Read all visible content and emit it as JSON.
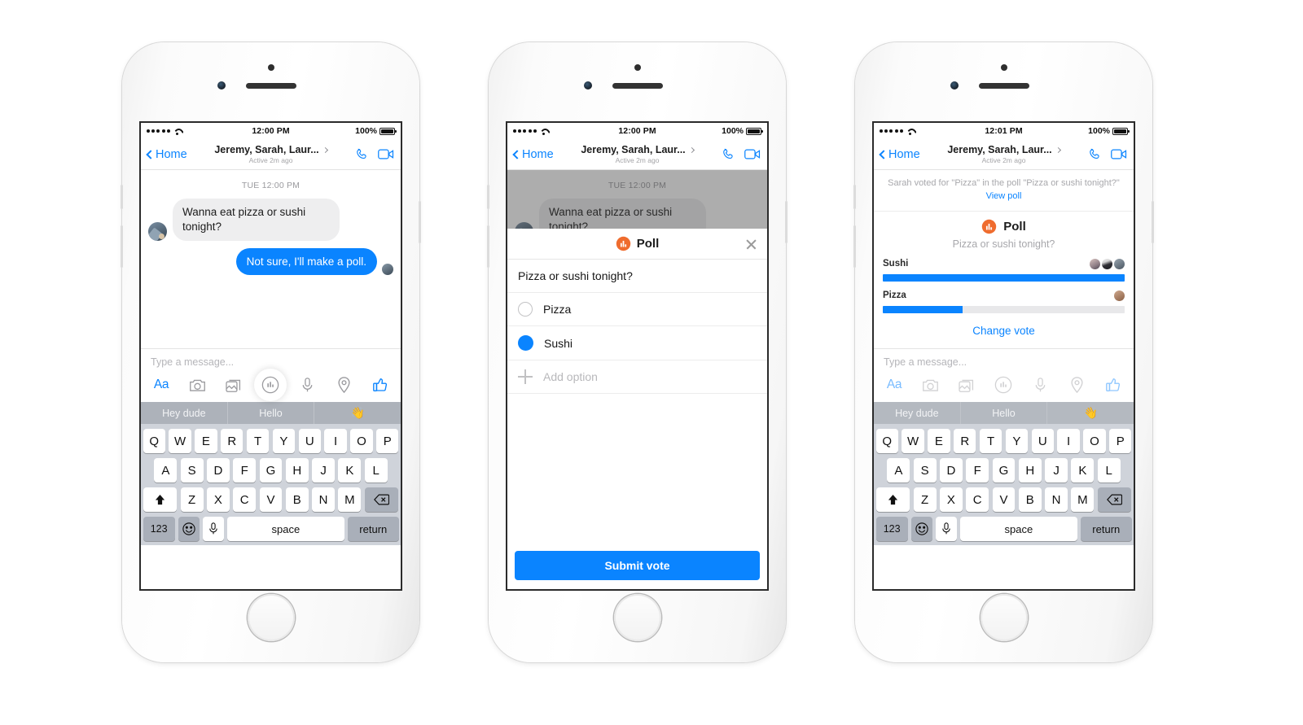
{
  "meta": {
    "accent": "#0a84ff",
    "poll_orange": "#ef6c2e",
    "bg": "#ffffff"
  },
  "keyboard": {
    "row1": [
      "Q",
      "W",
      "E",
      "R",
      "T",
      "Y",
      "U",
      "I",
      "O",
      "P"
    ],
    "row2": [
      "A",
      "S",
      "D",
      "F",
      "G",
      "H",
      "J",
      "K",
      "L"
    ],
    "row3": [
      "Z",
      "X",
      "C",
      "V",
      "B",
      "N",
      "M"
    ],
    "numeric_label": "123",
    "space_label": "space",
    "return_label": "return",
    "shift_icon": "shift-icon",
    "backspace_icon": "backspace-icon",
    "emoji_icon": "emoji-icon",
    "mic_icon": "microphone-icon"
  },
  "predictive": {
    "suggestion1": "Hey dude",
    "suggestion2": "Hello",
    "suggestion3": "👋"
  },
  "composer": {
    "placeholder": "Type a message...",
    "icons": [
      "text-format-icon",
      "camera-icon",
      "photo-gallery-icon",
      "poll-icon",
      "microphone-icon",
      "location-pin-icon",
      "thumbs-up-icon"
    ],
    "text_format_label": "Aa"
  },
  "phone1": {
    "status": {
      "time": "12:00 PM",
      "battery": "100%",
      "signal_dots": 5,
      "wifi": "wifi-icon"
    },
    "nav": {
      "back_label": "Home",
      "title": "Jeremy, Sarah, Laur...",
      "subtitle": "Active 2m ago",
      "call_icon": "phone-call-icon",
      "video_icon": "video-call-icon"
    },
    "thread": {
      "daystamp": "TUE 12:00 PM",
      "messages": [
        {
          "direction": "incoming",
          "text": "Wanna eat pizza or sushi tonight?"
        },
        {
          "direction": "outgoing",
          "text": "Not sure, I'll make a poll."
        }
      ]
    }
  },
  "phone2": {
    "status": {
      "time": "12:00 PM",
      "battery": "100%"
    },
    "nav": {
      "back_label": "Home",
      "title": "Jeremy, Sarah, Laur...",
      "subtitle": "Active 2m ago"
    },
    "thread": {
      "daystamp": "TUE 12:00 PM",
      "messages": [
        {
          "direction": "incoming",
          "text": "Wanna eat pizza or sushi tonight?"
        }
      ]
    },
    "modal": {
      "title": "Poll",
      "icon": "poll-icon",
      "close_icon": "close-icon",
      "question": "Pizza or sushi tonight?",
      "options": [
        {
          "label": "Pizza",
          "selected": false
        },
        {
          "label": "Sushi",
          "selected": true
        }
      ],
      "add_option_label": "Add option",
      "submit_label": "Submit vote"
    }
  },
  "phone3": {
    "status": {
      "time": "12:01 PM",
      "battery": "100%"
    },
    "nav": {
      "back_label": "Home",
      "title": "Jeremy, Sarah, Laur...",
      "subtitle": "Active 2m ago"
    },
    "system_note": {
      "text": "Sarah voted for \"Pizza\" in the poll \"Pizza or sushi tonight?\"",
      "link": "View poll"
    },
    "poll": {
      "title": "Poll",
      "icon": "poll-icon",
      "question": "Pizza or sushi tonight?",
      "change_vote_label": "Change vote",
      "results": [
        {
          "option": "Sushi",
          "percent": 100,
          "voters": 3
        },
        {
          "option": "Pizza",
          "percent": 33,
          "voters": 1
        }
      ]
    }
  }
}
